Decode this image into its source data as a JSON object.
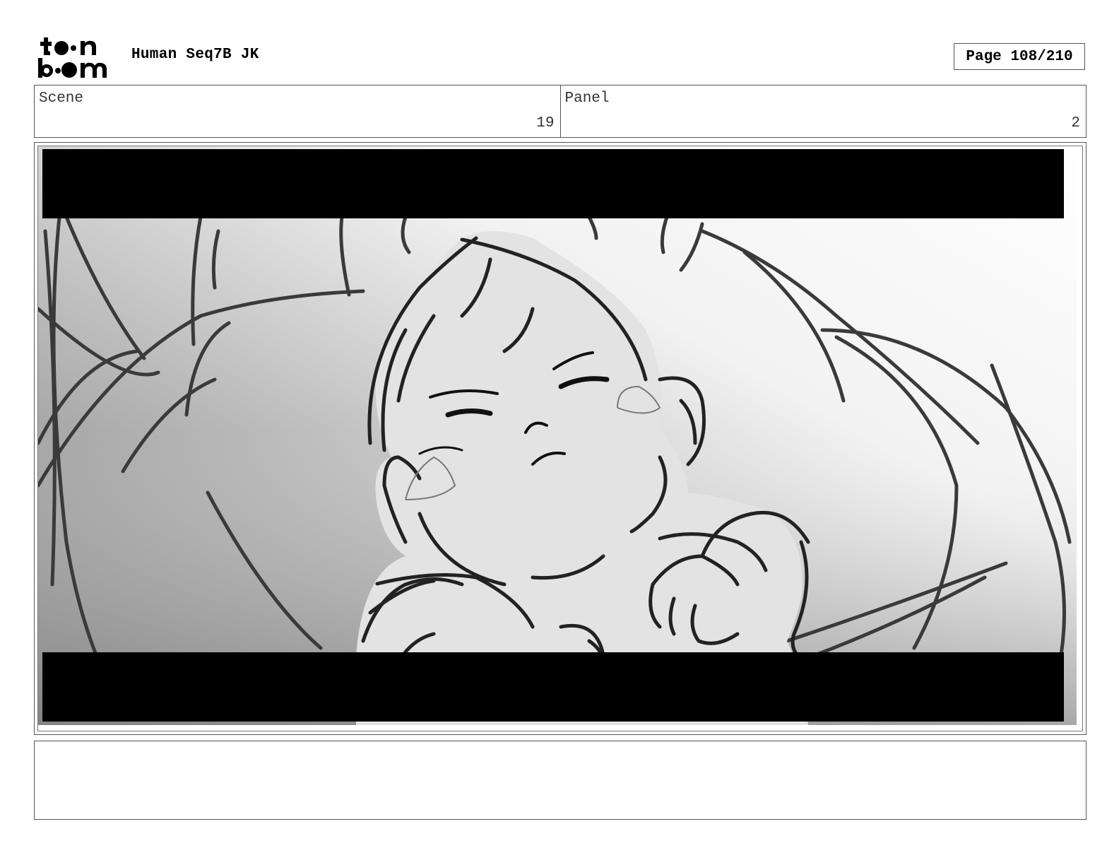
{
  "header": {
    "logo_text_top": "toon",
    "logo_text_bottom": "boom",
    "project_title": "Human Seq7B JK",
    "page_label": "Page 108/210"
  },
  "info": {
    "scene_label": "Scene",
    "scene_value": "19",
    "panel_label": "Panel",
    "panel_value": "2"
  },
  "frame": {
    "description_icon": "storyboard-sketch-image",
    "letterbox_color": "#000000"
  },
  "notes": {
    "text": ""
  }
}
